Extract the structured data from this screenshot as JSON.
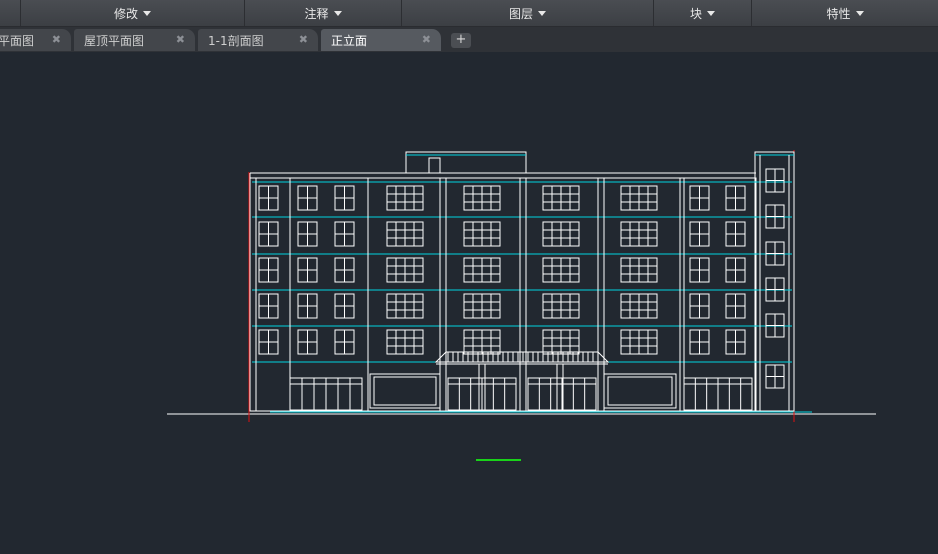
{
  "ribbon": {
    "panels": [
      {
        "label": "修改"
      },
      {
        "label": "注释"
      },
      {
        "label": "图层"
      },
      {
        "label": "块"
      },
      {
        "label": "特性"
      }
    ]
  },
  "tabs": [
    {
      "label": "平面图",
      "close": "✖"
    },
    {
      "label": "屋顶平面图",
      "close": "✖"
    },
    {
      "label": "1-1剖面图",
      "close": "✖"
    },
    {
      "label": "正立面",
      "close": "✖",
      "active": true
    }
  ],
  "new_tab": {
    "label": "+"
  },
  "drawing": {
    "colors": {
      "background": "#222830",
      "lines": "#ffffff",
      "floor_lines": "#00d5e0",
      "axis_lines": "#e01010",
      "ucs_marker": "#19d219"
    }
  }
}
